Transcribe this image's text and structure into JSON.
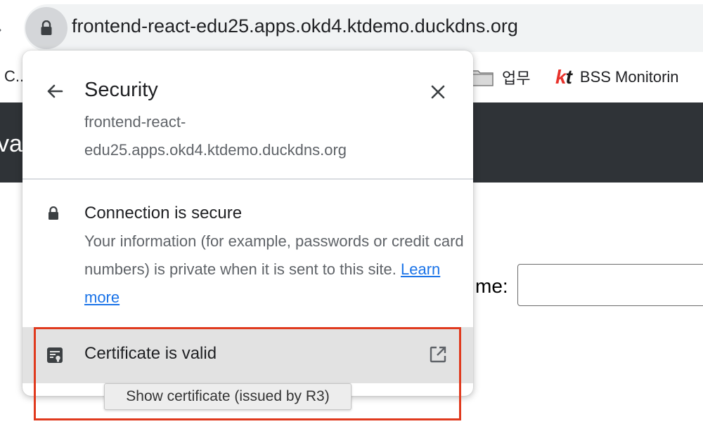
{
  "browser": {
    "url": "frontend-react-edu25.apps.okd4.ktdemo.duckdns.org",
    "bookmarks": [
      {
        "label": "C..",
        "icon": "bookmark-favicon"
      },
      {
        "label": "업무",
        "icon": "folder-icon"
      },
      {
        "label": "BSS Monitorin",
        "icon": "kt-logo"
      }
    ],
    "kt_logo_text": [
      "k",
      "t"
    ]
  },
  "page": {
    "band_text": "va",
    "field_label": "me:",
    "input_value": ""
  },
  "popup": {
    "title": "Security",
    "host": "frontend-react-edu25.apps.okd4.ktdemo.duckdns.org",
    "host_line1": "frontend-react-",
    "host_line2": "edu25.apps.okd4.ktdemo.duckdns.org",
    "connection": {
      "title": "Connection is secure",
      "description": "Your information (for example, passwords or credit card numbers) is private when it is sent to this site.",
      "learn_more": "Learn more"
    },
    "certificate": {
      "label": "Certificate is valid"
    },
    "tooltip": "Show certificate (issued by R3)"
  },
  "colors": {
    "highlight": "#e03a1e",
    "link": "#1a73e8",
    "dark_band": "#2f3337"
  }
}
